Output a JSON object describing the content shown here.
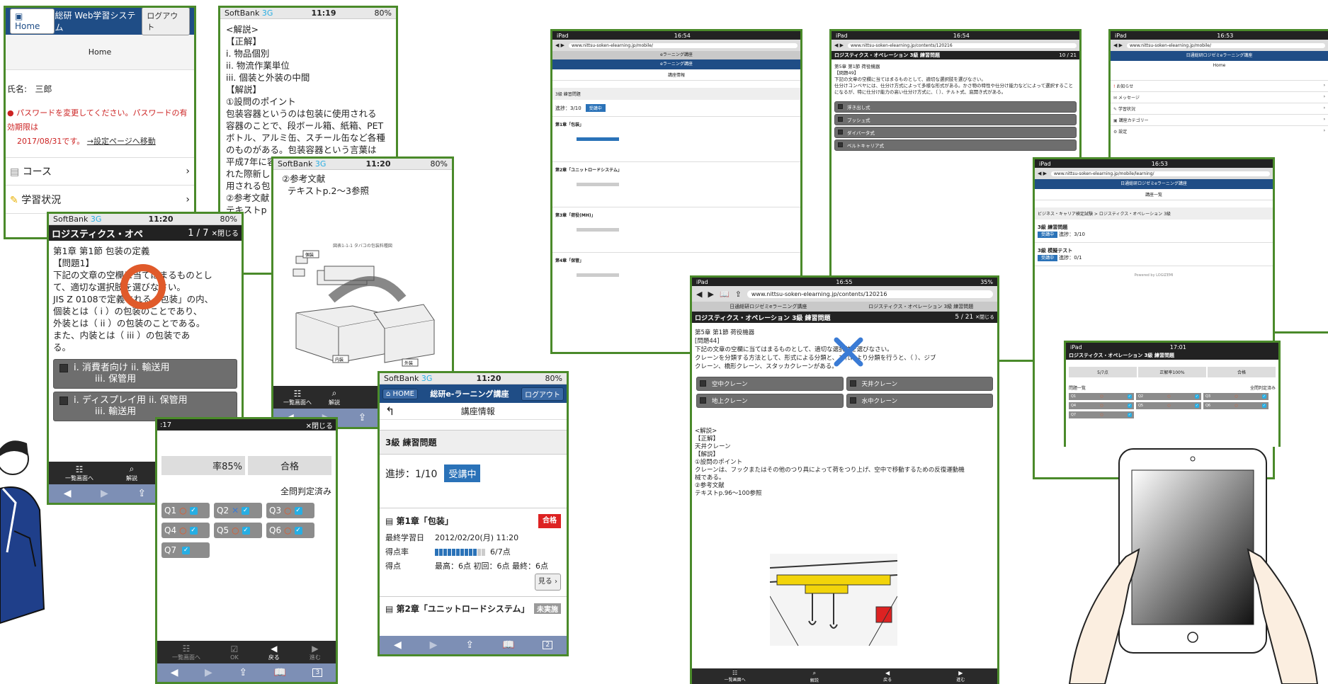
{
  "home_frame": {
    "home_btn": "Home",
    "title": "総研 Web学習システム",
    "logout_btn": "ログアウト",
    "subtitle": "Home",
    "name_label": "氏名:",
    "name_value": "三郎",
    "warning_line1": "パスワードを変更してください。パスワードの有効期限は",
    "warning_line2": "2017/08/31です。",
    "warning_link": "→設定ページへ移動",
    "menu_course": "コース",
    "menu_status": "学習状況"
  },
  "explain_frame": {
    "carrier": "SoftBank",
    "net": "3G",
    "time": "11:19",
    "battery": "80%",
    "lines": [
      "<解説>",
      "【正解】",
      "i.  物品個別",
      "ii.  物流作業単位",
      "iii.  個装と外装の中間",
      "【解説】",
      "①設問のポイント",
      "  包装容器というのは包装に使用される",
      "容器のことで、段ボール箱、紙箱、PET",
      "ボトル、アルミ缶、スチール缶など各種",
      "のものがある。包装容器という言葉は",
      "平成7年に容",
      "れた際新し",
      "用される包",
      "②参考文献",
      "テキストp"
    ]
  },
  "ref_frame": {
    "carrier": "SoftBank",
    "net": "3G",
    "time": "11:20",
    "battery": "80%",
    "ref_title": "②参考文献",
    "ref_text": "テキストp.2〜3参照",
    "fig_caption": "図表1-1-1  タバコの包装料種図",
    "label1": "個装",
    "label2": "内装",
    "label3": "外装",
    "tb_list": "一覧画面へ",
    "tb_explain": "解説"
  },
  "question_frame": {
    "carrier": "SoftBank",
    "net": "3G",
    "time": "11:20",
    "battery": "80%",
    "title": "ロジスティクス・オペ",
    "counter": "1 / 7",
    "close": "✕閉じる",
    "chapter": "第1章  第1節  包装の定義",
    "qnum": "【問題1】",
    "qtext1": "下記の文章の空欄に当てはまるものとし",
    "qtext2": "て、適切な選択肢を選びなさい。",
    "qtext3": "JIS Z 0108で定義される「包装」の内、",
    "qtext4": "個装とは（  i  ）の包装のことであり、",
    "qtext5": "外装とは（  ii  ）の包装のことである。",
    "qtext6": "また、内装とは（  iii  ）の包装であ",
    "qtext7": "る。",
    "opt1a": "i.  消費者向け      ii.  輸送用",
    "opt1b": "iii.  保管用",
    "opt2a": "i.  ディスプレイ用      ii.  保管用",
    "opt2b": "iii.  輸送用",
    "tb_list": "一覧画面へ",
    "tb_explain": "解説",
    "tb_back": "戻る",
    "tb_next": "進む",
    "tab_count": "4"
  },
  "result_frame": {
    "time": ":17",
    "close": "✕閉じる",
    "rate": "率85%",
    "pass": "合格",
    "judged": "全問判定済み",
    "qs": [
      "Q1",
      "Q2",
      "Q3",
      "Q4",
      "Q5",
      "Q6",
      "Q7"
    ],
    "tb_list": "一覧画面へ",
    "tb_ok": "OK",
    "tb_back": "戻る",
    "tb_next": "進む",
    "tab_count": "3"
  },
  "course_frame": {
    "carrier": "SoftBank",
    "net": "3G",
    "time": "11:20",
    "battery": "80%",
    "home": "HOME",
    "title": "総研e-ラーニング講座",
    "logout": "ログアウト",
    "header": "講座情報",
    "section": "3級 練習問題",
    "progress_label": "進捗：1/10",
    "status": "受講中",
    "ch1": "第1章「包装」",
    "ch1_badge": "合格",
    "last_label": "最終学習日",
    "last_value": "2012/02/20(月) 11:20",
    "rate_label": "得点率",
    "rate_value": "6/7点",
    "score_label": "得点",
    "score_value": "最高：6点  初回：6点  最終：6点",
    "view": "見る",
    "ch2": "第2章「ユニットロードシステム」",
    "ch2_badge": "未実施",
    "tab_count": "2"
  },
  "ipad_list": {
    "status_left": "iPad",
    "time": "16:54",
    "url": "www.nittsu-soken-elearning.jp/mobile/",
    "title": "eラーニング講座",
    "header": "講座情報",
    "section": "3級 練習問題",
    "progress": "進捗：3/10",
    "status": "受講中",
    "chapters": [
      "第1章「包装」",
      "第2章「ユニットロードシステム」",
      "第3章「荷役(MH)」",
      "第4章「保管」"
    ]
  },
  "ipad_q49": {
    "status_left": "iPad",
    "time": "16:54",
    "url": "www.nittsu-soken-elearning.jp/contents/120216",
    "header": "ロジスティクス・オペレーション  3級  練習問題",
    "counter": "10 / 21",
    "section": "第5章  第1節  荷役機器",
    "qnum": "【問題49】",
    "qtext": "下記の文章の空欄に当てはまるものとして、適切な選択肢を選びなさい。",
    "qtext2": "仕分けコンベヤには、仕分け方式によって多様な形式がある。かさ物の特性や仕分け能力などによって選択することになるが、特に仕分け能力の高い仕分け方式に、（  ）、チルト式、底開き式がある。",
    "options": [
      "浮き出し式",
      "プッシュ式",
      "ダイバータ式",
      "ベルトキャリア式"
    ]
  },
  "ipad_home": {
    "status_left": "iPad",
    "time": "16:53",
    "url": "www.nittsu-soken-elearning.jp/mobile/",
    "title": "日通総研ロジゼミeラーニング講座",
    "subtitle": "Home",
    "items": [
      "お知らせ",
      "メッセージ",
      "学習状況",
      "講座カテゴリー",
      "設定"
    ]
  },
  "ipad_courses": {
    "status_left": "iPad",
    "time": "16:53",
    "url": "www.nittsu-soken-elearning.jp/mobile/learning/",
    "title": "日通総研ロジゼミeラーニング講座",
    "header": "講座一覧",
    "breadcrumb": "ビジネス・キャリア検定試験 > ロジスティクス・オペレーション 3級",
    "c1": "3級 練習問題",
    "c1_progress": "進捗：3/10",
    "c2": "3級 模擬テスト",
    "c2_progress": "進捗：0/1",
    "status": "受講中",
    "footer": "Powered by LOGIZEMI"
  },
  "ipad_results": {
    "status_left": "iPad",
    "time": "17:01",
    "header": "ロジスティクス・オペレーション  3級  練習問題",
    "c1": "5/7点",
    "c2": "正解率100%",
    "c3": "合格",
    "list_label": "問題一覧",
    "judged": "全問判定済み",
    "qs": [
      "Q1",
      "Q2",
      "Q3",
      "Q4",
      "Q5",
      "Q6",
      "Q7"
    ]
  },
  "ipad_q44": {
    "status_left": "iPad",
    "time": "16:55",
    "battery": "35%",
    "url": "www.nittsu-soken-elearning.jp/contents/120216",
    "tab1": "日通総研ロジゼミeラーニング講座",
    "tab2": "ロジスティクス・オペレーション  3級  練習問題",
    "header": "ロジスティクス・オペレーション  3級  練習問題",
    "counter": "5 / 21",
    "close": "✕閉じる",
    "section": "第5章  第1節  荷役機器",
    "qnum": "[問題44]",
    "qtext1": "下記の文章の空欄に当てはまるものとして、適切な選択肢を選びなさい。",
    "qtext2": "クレーンを分類する方法として、形式による分類と、これにより分類を行うと、（    ）、ジブ",
    "qtext3": "クレーン、橋形クレーン、スタッカクレーンがある。",
    "options": [
      "空中クレーン",
      "天井クレーン",
      "地上クレーン",
      "水中クレーン"
    ],
    "exp": [
      "<解説>",
      "【正解】",
      "天井クレーン",
      "【解説】",
      "①設問のポイント",
      "  クレーンは、フックまたはその他のつり具によって荷をつり上げ、空中で移動するための反復運動機",
      "械である。",
      "②参考文献",
      "  テキストp.96〜100参照"
    ],
    "tb_list": "一覧画面へ",
    "tb_explain": "解説",
    "tb_back": "戻る",
    "tb_next": "進む"
  }
}
